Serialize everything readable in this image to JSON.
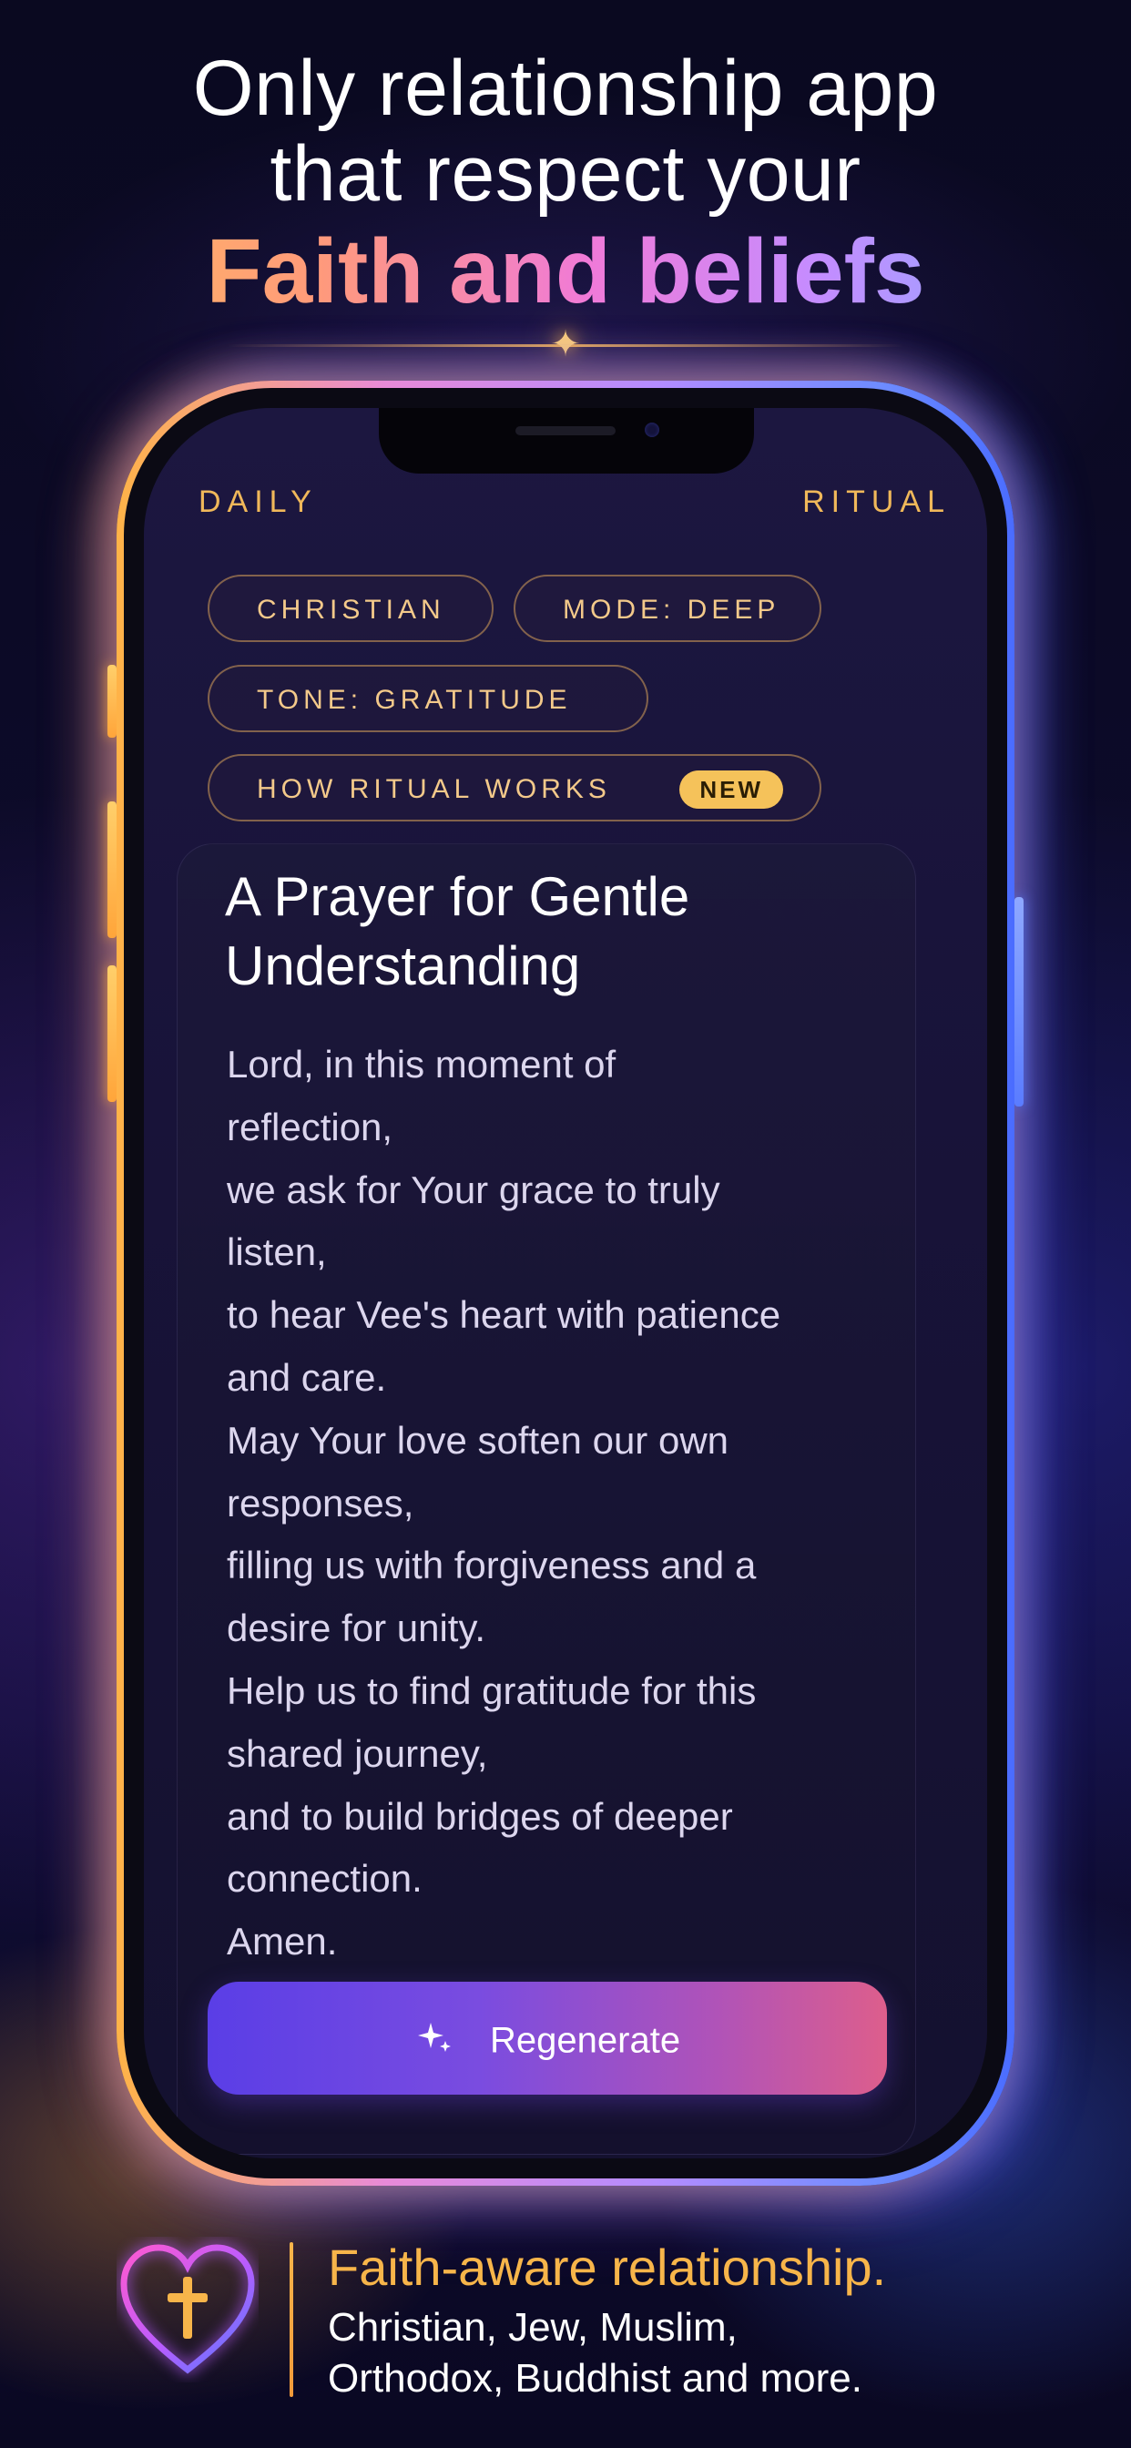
{
  "headline": {
    "line1": "Only relationship app",
    "line2": "that respect your",
    "accent": "Faith and beliefs"
  },
  "screen": {
    "header_left": "DAILY",
    "header_right": "RITUAL",
    "chips": {
      "faith": "CHRISTIAN",
      "mode": "MODE: DEEP",
      "tone": "TONE: GRATITUDE",
      "how": "HOW RITUAL WORKS",
      "how_badge": "NEW"
    },
    "card": {
      "title": "A Prayer for Gentle Understanding",
      "prayer_lines": [
        "Lord, in this moment of",
        "reflection,",
        "we ask for Your grace to truly",
        "listen,",
        "to hear Vee's heart with patience",
        "and care.",
        "May Your love soften our own",
        "responses,",
        "filling us with forgiveness and a",
        "desire for unity.",
        "Help us to find gratitude for this",
        "shared journey,",
        "and to build bridges of deeper",
        "connection.",
        "Amen."
      ]
    },
    "regenerate_label": "Regenerate"
  },
  "footer": {
    "title": "Faith-aware relationship.",
    "line1": "Christian, Jew, Muslim,",
    "line2": "Orthodox, Buddhist and more."
  },
  "colors": {
    "accent_gold": "#f0b85a",
    "button_start": "#5a3ee6",
    "button_end": "#dd5e8c"
  },
  "icons": [
    "sparkle-star-icon",
    "sparkles-icon",
    "heart-cross-icon"
  ]
}
